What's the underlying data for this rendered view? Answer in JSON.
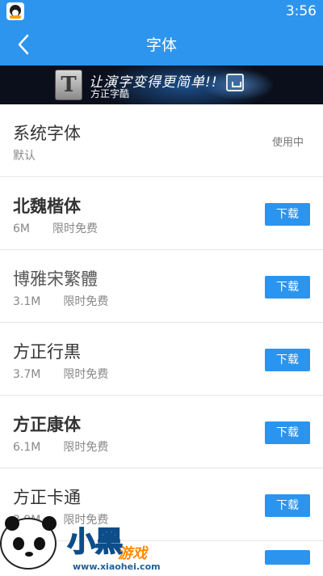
{
  "status_bar": {
    "time": "3:56"
  },
  "header": {
    "title": "字体"
  },
  "banner": {
    "slogan": "让演字变得更简单!!",
    "brand": "方正字酷",
    "logo_letter": "T"
  },
  "fonts": [
    {
      "name": "系统字体",
      "subtitle": "默认",
      "status": "使用中"
    },
    {
      "name": "北魏楷体",
      "size": "6M",
      "tag": "限时免费",
      "action": "下载"
    },
    {
      "name": "博雅宋繁體",
      "size": "3.1M",
      "tag": "限时免费",
      "action": "下载"
    },
    {
      "name": "方正行黒",
      "size": "3.7M",
      "tag": "限时免费",
      "action": "下载"
    },
    {
      "name": "方正康体",
      "size": "6.1M",
      "tag": "限时免费",
      "action": "下载"
    },
    {
      "name": "方正卡通",
      "size": "3.9M",
      "tag": "限时免费",
      "action": "下载"
    }
  ],
  "watermark": {
    "big": "小黑",
    "game": "游戏",
    "url": "www.xiaohei.com"
  },
  "colors": {
    "primary": "#2d95ee",
    "button": "#2b94ee"
  }
}
